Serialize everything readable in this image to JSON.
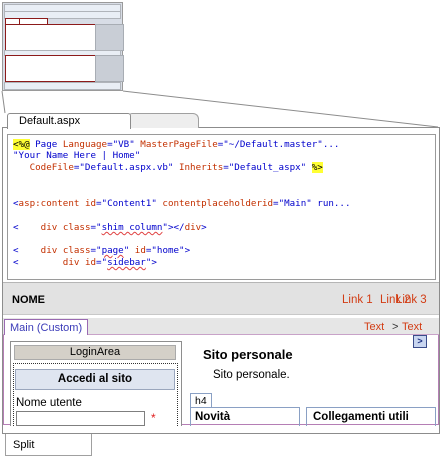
{
  "tabs": {
    "active": "Default.aspx"
  },
  "code_lines": [
    [
      [
        "hl",
        "<%@"
      ],
      [
        "b",
        " Page "
      ],
      [
        "m",
        "Language"
      ],
      [
        "b",
        "=\"VB\" "
      ],
      [
        "m",
        "MasterPageFile"
      ],
      [
        "b",
        "=\"~/Default.master\"..."
      ]
    ],
    [
      [
        "b",
        "\"Your Name Here | Home\""
      ]
    ],
    [
      [
        "m",
        "   CodeFile"
      ],
      [
        "b",
        "=\"Default.aspx.vb\" "
      ],
      [
        "m",
        "Inherits"
      ],
      [
        "b",
        "=\"Default_aspx\" "
      ],
      [
        "hl",
        "%>"
      ]
    ],
    [],
    [
      [
        "b",
        "<"
      ],
      [
        "m",
        "asp:content "
      ],
      [
        "m",
        "id"
      ],
      [
        "b",
        "=\"Content1\" "
      ],
      [
        "m",
        "contentplaceholderid"
      ],
      [
        "b",
        "=\"Main\" run..."
      ]
    ],
    [],
    [
      [
        "b",
        "<    "
      ],
      [
        "m",
        "div "
      ],
      [
        "m",
        "class"
      ],
      [
        "b",
        "=\""
      ],
      [
        "b",
        "shim column"
      ],
      [
        "b",
        "\"></"
      ],
      [
        "m",
        "div"
      ],
      [
        "b",
        ">"
      ]
    ],
    [],
    [
      [
        "b",
        "<    "
      ],
      [
        "m",
        "div "
      ],
      [
        "m",
        "class"
      ],
      [
        "b",
        "=\""
      ],
      [
        "b",
        "page"
      ],
      [
        "b",
        "\" "
      ],
      [
        "m",
        "id"
      ],
      [
        "b",
        "=\"home\">"
      ]
    ],
    [
      [
        "b",
        "<        "
      ],
      [
        "m",
        "div "
      ],
      [
        "m",
        "id"
      ],
      [
        "b",
        "=\""
      ],
      [
        "b",
        "sidebar"
      ],
      [
        "b",
        "\">"
      ]
    ]
  ],
  "header": {
    "site_name": "NOME",
    "links": [
      "Link 1",
      "Link 2",
      "Link 3"
    ]
  },
  "main_bar": {
    "tag": "Main (Custom)",
    "crumb_text": "Text",
    "crumb_arrow": ">",
    "crumb_text2": "Text"
  },
  "login": {
    "area_title": "LoginArea",
    "button": "Accedi al sito",
    "user_label": "Nome utente",
    "required_mark": "*"
  },
  "content": {
    "title": "Sito personale",
    "subtitle": "Sito personale.",
    "h4_tag": "h4",
    "news": "Novità",
    "links": "Collegamenti utili",
    "expand": ">"
  },
  "split_button": "Split",
  "colors": {
    "link": "#d23c14",
    "highlight": "#ffff33",
    "tag_border": "#9a6ab2",
    "login_button_bg": "#dfe5f0"
  }
}
